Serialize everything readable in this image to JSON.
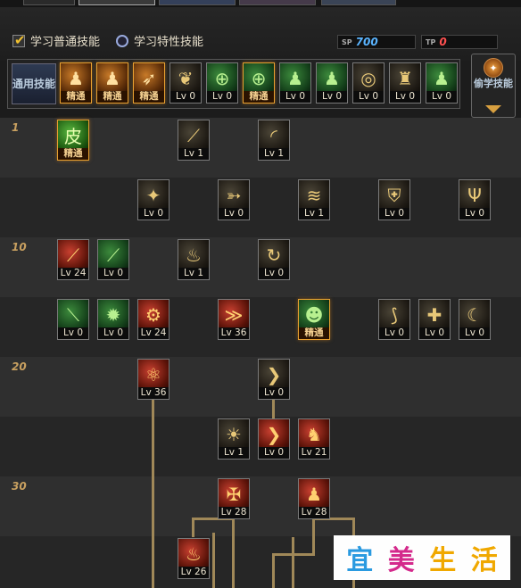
{
  "header": {
    "learn_normal": "学习普通技能",
    "learn_trait": "学习特性技能",
    "sp": {
      "value": "700",
      "color": "#5ab4ff"
    },
    "tp": {
      "value": "0",
      "color": "#ff5050"
    }
  },
  "general": {
    "label": "通用技能",
    "skills": [
      {
        "lv": "精通",
        "mastered": true,
        "theme": "orange",
        "icon": "figure-icon"
      },
      {
        "lv": "精通",
        "mastered": true,
        "theme": "orange",
        "icon": "figure-icon"
      },
      {
        "lv": "精通",
        "mastered": true,
        "theme": "orange",
        "icon": "running-figure-icon"
      },
      {
        "lv": "Lv 0",
        "mastered": false,
        "theme": "dark",
        "icon": "wings-icon"
      },
      {
        "lv": "Lv 0",
        "mastered": false,
        "theme": "green",
        "icon": "crosshair-icon"
      },
      {
        "lv": "精通",
        "mastered": true,
        "theme": "green",
        "icon": "crosshair-icon"
      },
      {
        "lv": "Lv 0",
        "mastered": false,
        "theme": "green",
        "icon": "figure-icon"
      },
      {
        "lv": "Lv 0",
        "mastered": false,
        "theme": "green",
        "icon": "figure-icon"
      },
      {
        "lv": "Lv 0",
        "mastered": false,
        "theme": "dark",
        "icon": "spiral-icon"
      },
      {
        "lv": "Lv 0",
        "mastered": false,
        "theme": "dark",
        "icon": "strongman-icon"
      },
      {
        "lv": "Lv 0",
        "mastered": false,
        "theme": "green",
        "icon": "figure-icon"
      }
    ]
  },
  "thief": {
    "label": "偷学技能",
    "icon": "orb-icon"
  },
  "rows": [
    {
      "label": "1"
    },
    {
      "label": ""
    },
    {
      "label": "10"
    },
    {
      "label": ""
    },
    {
      "label": "20"
    },
    {
      "label": ""
    },
    {
      "label": "30"
    },
    {
      "label": ""
    }
  ],
  "tree": [
    {
      "row": 0,
      "col": 64,
      "lv": "精通",
      "mastered": true,
      "theme": "lime",
      "icon": "skin-skill-icon",
      "glyph": "皮"
    },
    {
      "row": 0,
      "col": 199,
      "lv": "Lv 1",
      "mastered": false,
      "theme": "dark",
      "icon": "claw-slash-icon",
      "glyph": "⟋"
    },
    {
      "row": 0,
      "col": 289,
      "lv": "Lv 1",
      "mastered": false,
      "theme": "dark",
      "icon": "slash-arc-icon",
      "glyph": "◜"
    },
    {
      "row": 1,
      "col": 154,
      "lv": "Lv 0",
      "mastered": false,
      "theme": "dark",
      "icon": "sword-burst-icon",
      "glyph": "✦"
    },
    {
      "row": 1,
      "col": 244,
      "lv": "Lv 0",
      "mastered": false,
      "theme": "dark",
      "icon": "arrow-icon",
      "glyph": "➳"
    },
    {
      "row": 1,
      "col": 334,
      "lv": "Lv 1",
      "mastered": false,
      "theme": "dark",
      "icon": "wind-wave-icon",
      "glyph": "≋"
    },
    {
      "row": 1,
      "col": 424,
      "lv": "Lv 0",
      "mastered": false,
      "theme": "dark",
      "icon": "shield-icon",
      "glyph": "⛨"
    },
    {
      "row": 1,
      "col": 514,
      "lv": "Lv 0",
      "mastered": false,
      "theme": "dark",
      "icon": "triple-blade-icon",
      "glyph": "Ψ"
    },
    {
      "row": 2,
      "col": 64,
      "lv": "Lv 24",
      "mastered": false,
      "theme": "red",
      "icon": "blade-icon",
      "glyph": "⟋"
    },
    {
      "row": 2,
      "col": 109,
      "lv": "Lv 0",
      "mastered": false,
      "theme": "green",
      "icon": "green-blade-icon",
      "glyph": "⟋"
    },
    {
      "row": 2,
      "col": 199,
      "lv": "Lv 1",
      "mastered": false,
      "theme": "dark",
      "icon": "flame-icon",
      "glyph": "♨"
    },
    {
      "row": 2,
      "col": 289,
      "lv": "Lv 0",
      "mastered": false,
      "theme": "dark",
      "icon": "whirl-icon",
      "glyph": "↻"
    },
    {
      "row": 3,
      "col": 64,
      "lv": "Lv 0",
      "mastered": false,
      "theme": "green",
      "icon": "green-slash-icon",
      "glyph": "⟍"
    },
    {
      "row": 3,
      "col": 109,
      "lv": "Lv 0",
      "mastered": false,
      "theme": "green",
      "icon": "burst-icon",
      "glyph": "✹"
    },
    {
      "row": 3,
      "col": 154,
      "lv": "Lv 24",
      "mastered": false,
      "theme": "red",
      "icon": "gear-icon",
      "glyph": "⚙"
    },
    {
      "row": 3,
      "col": 244,
      "lv": "Lv 36",
      "mastered": false,
      "theme": "red",
      "icon": "rush-icon",
      "glyph": "≫"
    },
    {
      "row": 3,
      "col": 334,
      "lv": "精通",
      "mastered": true,
      "theme": "green",
      "icon": "head-sparkle-icon",
      "glyph": "☻"
    },
    {
      "row": 3,
      "col": 424,
      "lv": "Lv 0",
      "mastered": false,
      "theme": "dark",
      "icon": "swirl-slash-icon",
      "glyph": "⟆"
    },
    {
      "row": 3,
      "col": 469,
      "lv": "Lv 0",
      "mastered": false,
      "theme": "dark",
      "icon": "cross-flash-icon",
      "glyph": "✚"
    },
    {
      "row": 3,
      "col": 514,
      "lv": "Lv 0",
      "mastered": false,
      "theme": "dark",
      "icon": "crescent-icon",
      "glyph": "☾"
    },
    {
      "row": 4,
      "col": 154,
      "lv": "Lv 36",
      "mastered": false,
      "theme": "red",
      "icon": "rune-seal-icon",
      "glyph": "⚛"
    },
    {
      "row": 4,
      "col": 289,
      "lv": "Lv 0",
      "mastered": false,
      "theme": "dark",
      "icon": "chevron-right-icon",
      "glyph": "❯"
    },
    {
      "row": 5,
      "col": 244,
      "lv": "Lv 1",
      "mastered": false,
      "theme": "dark",
      "icon": "sun-face-icon",
      "glyph": "☀"
    },
    {
      "row": 5,
      "col": 289,
      "lv": "Lv 0",
      "mastered": false,
      "theme": "red",
      "icon": "green-arrow-icon",
      "glyph": "❯"
    },
    {
      "row": 5,
      "col": 334,
      "lv": "Lv 21",
      "mastered": false,
      "theme": "red",
      "icon": "warrior-icon",
      "glyph": "♞"
    },
    {
      "row": 6,
      "col": 244,
      "lv": "Lv 28",
      "mastered": false,
      "theme": "red",
      "icon": "cross-burst-icon",
      "glyph": "✠"
    },
    {
      "row": 6,
      "col": 334,
      "lv": "Lv 28",
      "mastered": false,
      "theme": "red",
      "icon": "torso-icon",
      "glyph": "♟"
    },
    {
      "row": 7,
      "col": 199,
      "lv": "Lv 26",
      "mastered": false,
      "theme": "red",
      "icon": "fire-icon",
      "glyph": "♨"
    }
  ],
  "watermark": {
    "chars": [
      {
        "t": "宜",
        "c": "#2a9ae0"
      },
      {
        "t": "美",
        "c": "#d42a8c"
      },
      {
        "t": "生",
        "c": "#f0a800"
      },
      {
        "t": "活",
        "c": "#f0a800"
      }
    ]
  }
}
